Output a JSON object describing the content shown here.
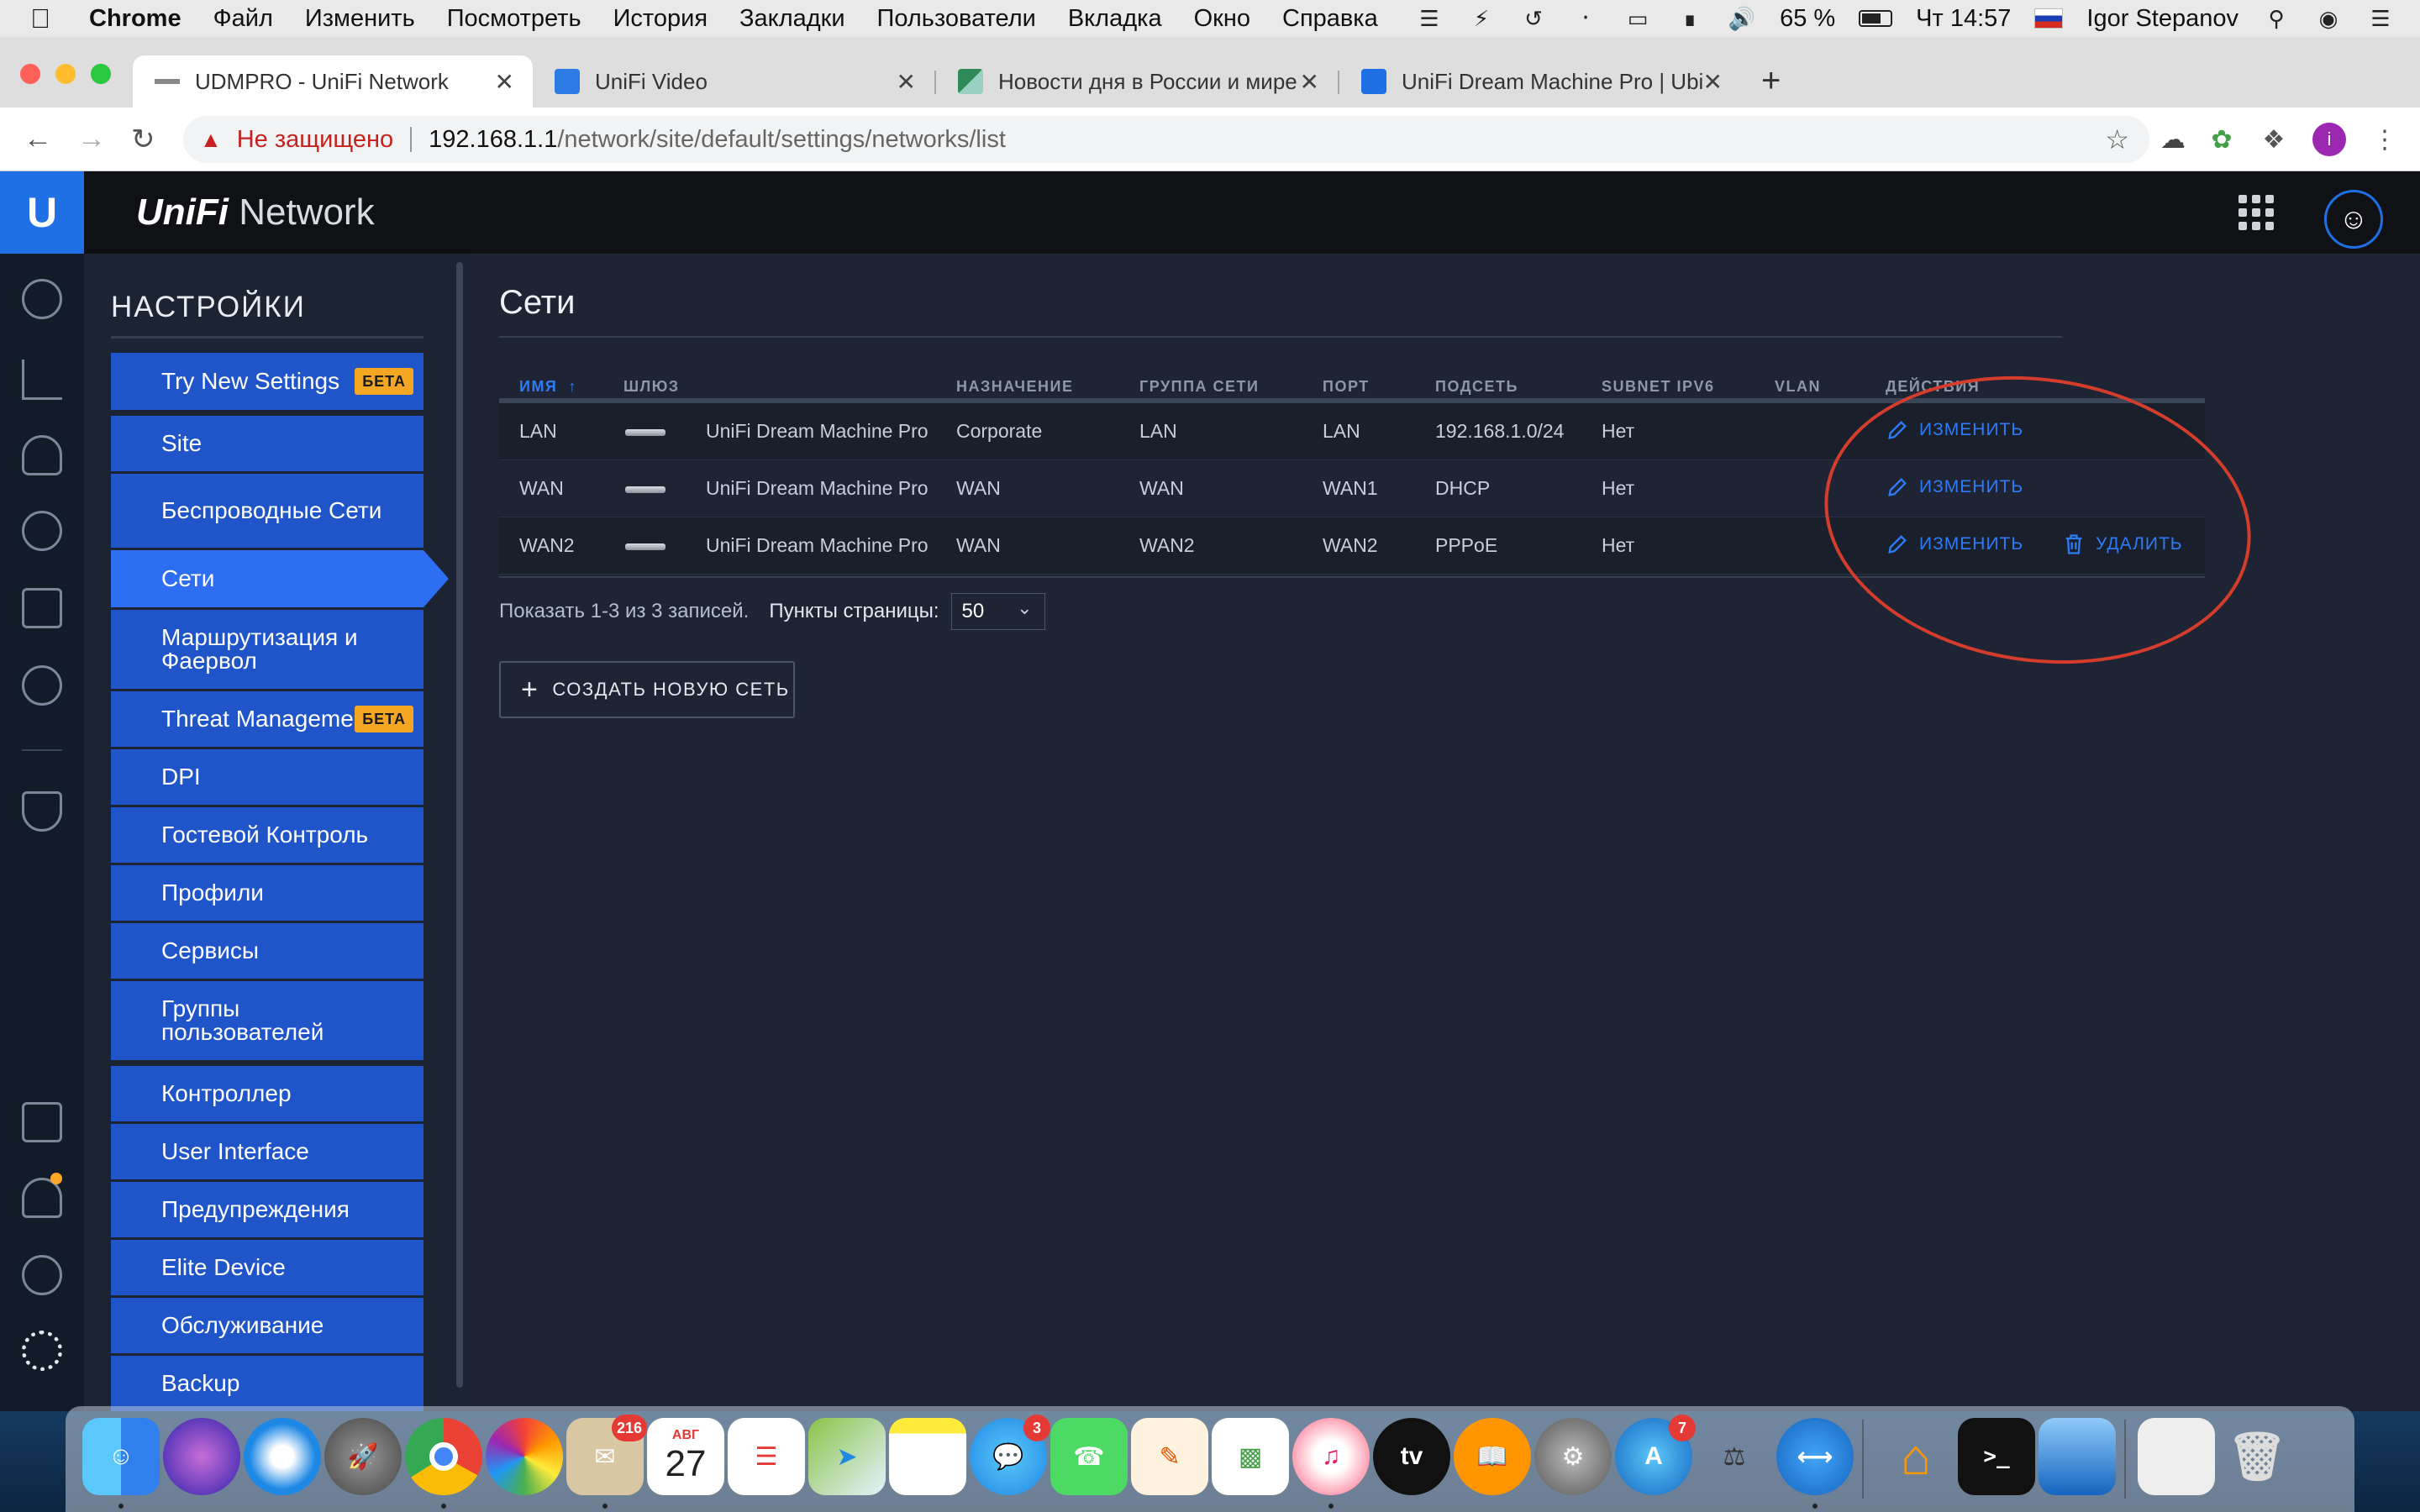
{
  "menubar": {
    "app": "Chrome",
    "items": [
      "Файл",
      "Изменить",
      "Посмотреть",
      "История",
      "Закладки",
      "Пользователи",
      "Вкладка",
      "Окно",
      "Справка"
    ],
    "battery": "65 %",
    "clock": "Чт 14:57",
    "user": "Igor Stepanov"
  },
  "tabs": [
    {
      "title": "UDMPRO - UniFi Network",
      "active": true
    },
    {
      "title": "UniFi Video"
    },
    {
      "title": "Новости дня в России и мире"
    },
    {
      "title": "UniFi Dream Machine Pro | Ubi"
    }
  ],
  "address": {
    "insecure": "Не защищено",
    "host": "192.168.1.1",
    "path": "/network/site/default/settings/networks/list"
  },
  "app_header": {
    "brand_part1": "UniFi",
    "brand_part2": " Network",
    "logo_letter": "U"
  },
  "settings": {
    "title": "НАСТРОЙКИ",
    "items": [
      {
        "label": "Try New Settings",
        "badge": "БЕТА"
      },
      {
        "label": "Site"
      },
      {
        "label": "Беспроводные Сети"
      },
      {
        "label": "Сети",
        "active": true
      },
      {
        "label": "Маршрутизация и Фаервол"
      },
      {
        "label": "Threat Manageme",
        "badge": "БЕТА"
      },
      {
        "label": "DPI"
      },
      {
        "label": "Гостевой Контроль"
      },
      {
        "label": "Профили"
      },
      {
        "label": "Сервисы"
      },
      {
        "label": "Группы пользователей"
      },
      {
        "label": "Контроллер"
      },
      {
        "label": "User Interface"
      },
      {
        "label": "Предупреждения"
      },
      {
        "label": "Elite Device"
      },
      {
        "label": "Обслуживание"
      },
      {
        "label": "Backup"
      }
    ]
  },
  "main": {
    "title": "Сети",
    "columns": {
      "name": "ИМЯ",
      "sort_arrow": "↑",
      "gateway": "ШЛЮЗ",
      "purpose": "НАЗНАЧЕНИЕ",
      "group": "ГРУППА СЕТИ",
      "port": "ПОРТ",
      "subnet": "ПОДСЕТЬ",
      "ipv6": "SUBNET IPV6",
      "vlan": "VLAN",
      "actions": "ДЕЙСТВИЯ"
    },
    "rows": [
      {
        "name": "LAN",
        "gateway": "UniFi Dream Machine Pro",
        "purpose": "Corporate",
        "group": "LAN",
        "port": "LAN",
        "subnet": "192.168.1.0/24",
        "ipv6": "Нет",
        "vlan": "",
        "edit": "ИЗМЕНИТЬ"
      },
      {
        "name": "WAN",
        "gateway": "UniFi Dream Machine Pro",
        "purpose": "WAN",
        "group": "WAN",
        "port": "WAN1",
        "subnet": "DHCP",
        "ipv6": "Нет",
        "vlan": "",
        "edit": "ИЗМЕНИТЬ"
      },
      {
        "name": "WAN2",
        "gateway": "UniFi Dream Machine Pro",
        "purpose": "WAN",
        "group": "WAN2",
        "port": "WAN2",
        "subnet": "PPPoE",
        "ipv6": "Нет",
        "vlan": "",
        "edit": "ИЗМЕНИТЬ",
        "delete": "УДАЛИТЬ"
      }
    ],
    "pager": {
      "showing": "Показать 1-3 из 3 записей.",
      "per_page_label": "Пункты страницы:",
      "per_page_value": "50"
    },
    "create_button": "СОЗДАТЬ НОВУЮ СЕТЬ"
  },
  "dock": {
    "mail_badge": "216",
    "calendar_month": "АВГ",
    "calendar_day": "27",
    "messages_badge": "3",
    "appstore_badge": "7"
  },
  "colors": {
    "accent": "#2d7cf6",
    "nav_item": "#1f55c9",
    "annotation": "#d43d2c",
    "beta_badge": "#f5a623"
  }
}
